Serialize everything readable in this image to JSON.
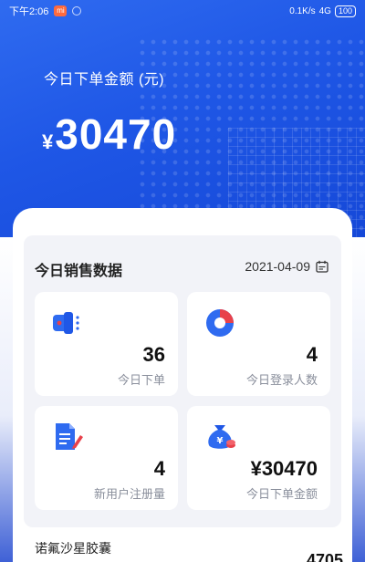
{
  "status_bar": {
    "time": "下午2:06",
    "app_badge": "mi",
    "net_speed": "0.1K/s",
    "signal": "4G",
    "battery": "100"
  },
  "hero": {
    "label": "今日下单金额 (元)",
    "currency": "¥",
    "amount": "30470"
  },
  "panel": {
    "title": "今日销售数据",
    "date": "2021-04-09",
    "cards": [
      {
        "icon": "megaphone-icon",
        "value": "36",
        "label": "今日下单"
      },
      {
        "icon": "pie-chart-icon",
        "value": "4",
        "label": "今日登录人数"
      },
      {
        "icon": "document-pen-icon",
        "value": "4",
        "label": "新用户注册量"
      },
      {
        "icon": "money-bag-icon",
        "value": "¥30470",
        "label": "今日下单金额"
      }
    ]
  },
  "product": {
    "name": "诺氟沙星胶囊",
    "amount": "4705"
  },
  "colors": {
    "primary": "#1f57e6",
    "accent_red": "#e8414b",
    "panel_bg": "#f2f3f8"
  }
}
